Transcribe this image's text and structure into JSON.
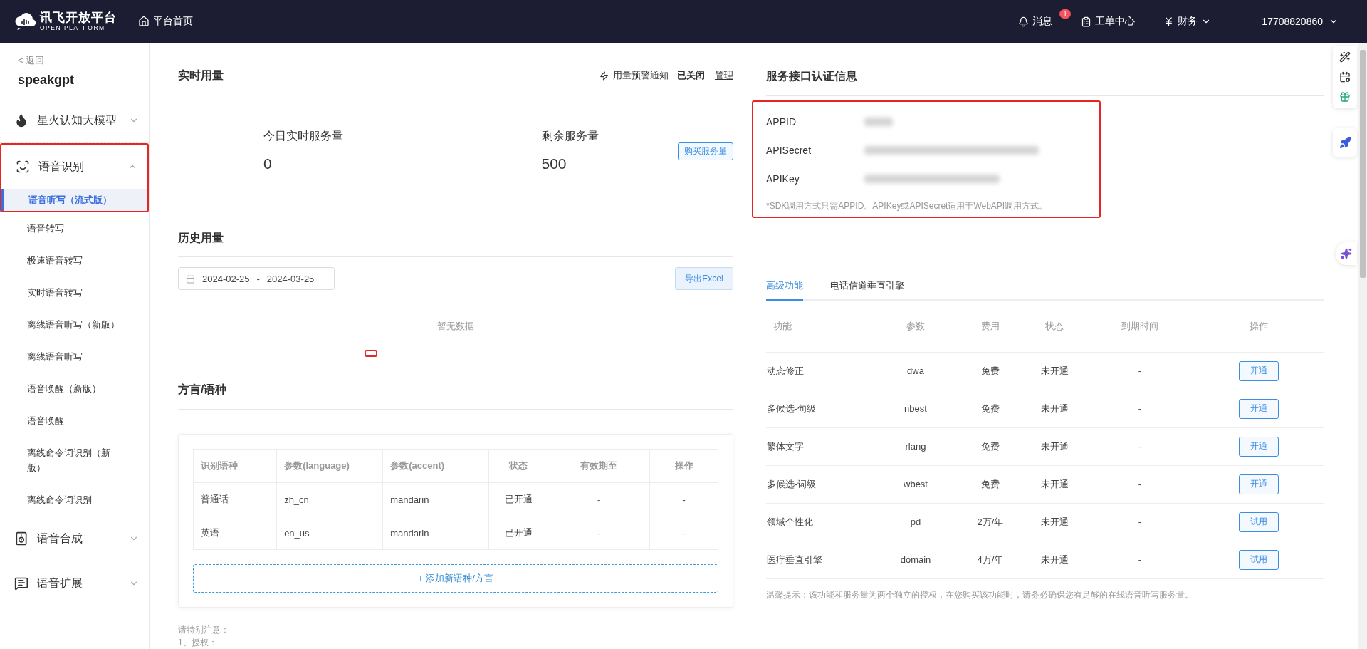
{
  "topbar": {
    "logo": {
      "title": "讯飞开放平台",
      "subtitle": "OPEN PLATFORM"
    },
    "home_link": "平台首页",
    "nav": [
      {
        "kind": "bell",
        "label": "消息",
        "badge": "1"
      },
      {
        "kind": "ticket",
        "label": "工单中心"
      },
      {
        "kind": "finance",
        "label": "财务",
        "dropdown": true
      }
    ],
    "user": "17708820860"
  },
  "sidebar": {
    "back": "< 返回",
    "app": "speakgpt",
    "groups": [
      {
        "kind": "spark",
        "label": "星火认知大模型",
        "expanded": false,
        "highlighted": false
      },
      {
        "kind": "asr",
        "label": "语音识别",
        "expanded": true,
        "highlighted": true,
        "children": [
          {
            "label": "语音听写（流式版）",
            "selected": true
          },
          {
            "label": "语音转写",
            "selected": false
          },
          {
            "label": "极速语音转写",
            "selected": false
          },
          {
            "label": "实时语音转写",
            "selected": false
          },
          {
            "label": "离线语音听写（新版）",
            "selected": false
          },
          {
            "label": "离线语音听写",
            "selected": false
          },
          {
            "label": "语音唤醒（新版）",
            "selected": false
          },
          {
            "label": "语音唤醒",
            "selected": false
          },
          {
            "label": "离线命令词识别（新版）",
            "selected": false
          },
          {
            "label": "离线命令词识别",
            "selected": false
          }
        ]
      },
      {
        "kind": "tts",
        "label": "语音合成",
        "expanded": false,
        "highlighted": false
      },
      {
        "kind": "ext",
        "label": "语音扩展",
        "expanded": false,
        "highlighted": false
      }
    ]
  },
  "realtime": {
    "title": "实时用量",
    "alert": {
      "label": "用量预警通知",
      "status": "已关闭",
      "manage": "管理"
    },
    "stats": [
      {
        "label": "今日实时服务量",
        "value": "0"
      },
      {
        "label": "剩余服务量",
        "value": "500"
      }
    ],
    "buy_button": "购买服务量"
  },
  "history": {
    "title": "历史用量",
    "date_range": {
      "start": "2024-02-25",
      "separator": "-",
      "end": "2024-03-25"
    },
    "export_button": "导出Excel",
    "empty_text": "暂无数据"
  },
  "dialects": {
    "title": "方言/语种",
    "columns": [
      "识别语种",
      "参数(language)",
      "参数(accent)",
      "状态",
      "有效期至",
      "操作"
    ],
    "rows": [
      [
        "普通话",
        "zh_cn",
        "mandarin",
        "已开通",
        "-",
        "-"
      ],
      [
        "英语",
        "en_us",
        "mandarin",
        "已开通",
        "-",
        "-"
      ]
    ],
    "add_button": "+ 添加新语种/方言",
    "notes": [
      "请特别注意：",
      "1、授权："
    ]
  },
  "credentials": {
    "title": "服务接口认证信息",
    "fields": [
      {
        "label": "APPID",
        "redacted": true
      },
      {
        "label": "APISecret",
        "redacted": true
      },
      {
        "label": "APIKey",
        "redacted": true
      }
    ],
    "note": "*SDK调用方式只需APPID。APIKey或APISecret适用于WebAPI调用方式。"
  },
  "features": {
    "tabs": [
      {
        "label": "高级功能",
        "selected": true
      },
      {
        "label": "电话信道垂直引擎",
        "selected": false
      }
    ],
    "columns": [
      "功能",
      "参数",
      "费用",
      "状态",
      "到期时间",
      "操作"
    ],
    "rows": [
      [
        "动态修正",
        "dwa",
        "免费",
        "未开通",
        "-",
        "开通"
      ],
      [
        "多候选-句级",
        "nbest",
        "免费",
        "未开通",
        "-",
        "开通"
      ],
      [
        "繁体文字",
        "rlang",
        "免费",
        "未开通",
        "-",
        "开通"
      ],
      [
        "多候选-词级",
        "wbest",
        "免费",
        "未开通",
        "-",
        "开通"
      ],
      [
        "领域个性化",
        "pd",
        "2万/年",
        "未开通",
        "-",
        "试用"
      ],
      [
        "医疗垂直引擎",
        "domain",
        "4万/年",
        "未开通",
        "-",
        "试用"
      ]
    ],
    "tip": "温馨提示：该功能和服务量为两个独立的授权，在您购买该功能时，请务必确保您有足够的在线语音听写服务量。"
  }
}
